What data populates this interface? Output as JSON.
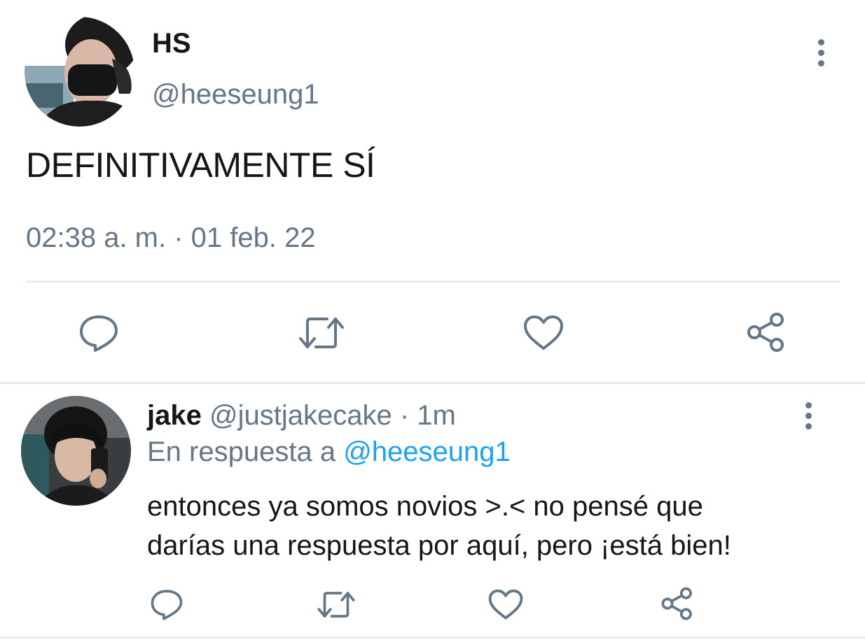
{
  "main_tweet": {
    "display_name": "HS",
    "handle": "@heeseung1",
    "text": "DEFINITIVAMENTE SÍ",
    "timestamp": "02:38 a. m. · 01 feb. 22",
    "actions": {
      "reply_icon": "reply-icon",
      "retweet_icon": "retweet-icon",
      "like_icon": "like-icon",
      "share_icon": "share-icon"
    },
    "more_icon": "more-vertical-icon"
  },
  "reply_tweet": {
    "display_name": "jake",
    "handle": "@justjakecake",
    "time": "· 1m",
    "reply_prefix": "En respuesta a",
    "reply_to": "@heeseung1",
    "text_line1": "entonces ya somos novios >.< no pensé que",
    "text_line2": "darías una respuesta por aquí, pero ¡está bien!",
    "more_icon": "more-vertical-icon"
  },
  "colors": {
    "primary_text": "#14171a",
    "secondary_text": "#657786",
    "link": "#1da1f2",
    "divider": "#e6ecf0"
  }
}
